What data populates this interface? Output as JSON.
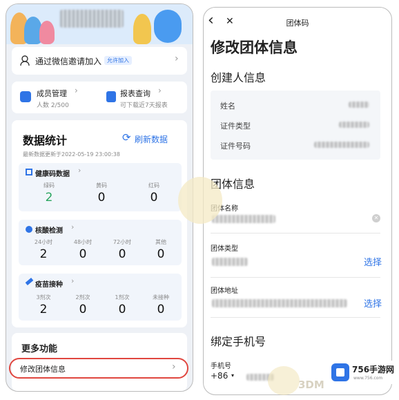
{
  "left": {
    "invite": {
      "label": "通过微信邀请加入",
      "badge": "允许加入"
    },
    "members": {
      "title": "成员管理",
      "sub": "人数 2/500"
    },
    "reports": {
      "title": "报表查询",
      "sub": "可下载近7天报表"
    },
    "stats": {
      "title": "数据统计",
      "refresh": "刷新数据",
      "updated": "最新数据更新于2022-05-19 23:00:38",
      "health": {
        "title": "健康码数据",
        "items": [
          {
            "label": "绿码",
            "value": "2",
            "color": "#2aa55f"
          },
          {
            "label": "黄码",
            "value": "0",
            "color": "#111111"
          },
          {
            "label": "红码",
            "value": "0",
            "color": "#111111"
          }
        ]
      },
      "nucleic": {
        "title": "核酸检测",
        "items": [
          {
            "label": "24小时",
            "value": "2"
          },
          {
            "label": "48小时",
            "value": "0"
          },
          {
            "label": "72小时",
            "value": "0"
          },
          {
            "label": "其他",
            "value": "0"
          }
        ]
      },
      "vaccine": {
        "title": "疫苗接种",
        "items": [
          {
            "label": "3剂次",
            "value": "2"
          },
          {
            "label": "2剂次",
            "value": "0"
          },
          {
            "label": "1剂次",
            "value": "0"
          },
          {
            "label": "未接种",
            "value": "0"
          }
        ]
      }
    },
    "more": {
      "title": "更多功能",
      "edit_item": "修改团体信息"
    }
  },
  "right": {
    "nav": {
      "title": "团体码",
      "back": "‹",
      "close": "✕"
    },
    "page_title": "修改团体信息",
    "creator_section": "创建人信息",
    "creator_fields": [
      {
        "label": "姓名"
      },
      {
        "label": "证件类型"
      },
      {
        "label": "证件号码"
      }
    ],
    "group_section": "团体信息",
    "group_name_label": "团体名称",
    "group_type_label": "团体类型",
    "group_type_action": "选择",
    "group_address_label": "团体地址",
    "group_address_action": "选择",
    "phone_section": "绑定手机号",
    "phone_label": "手机号",
    "phone_prefix": "+86"
  },
  "watermark": {
    "brand": "756手游网",
    "site": "www.756.com",
    "overlay": "3DM"
  },
  "colors": {
    "accent": "#2f74e6",
    "highlight": "#e0463f",
    "green": "#2aa55f"
  }
}
